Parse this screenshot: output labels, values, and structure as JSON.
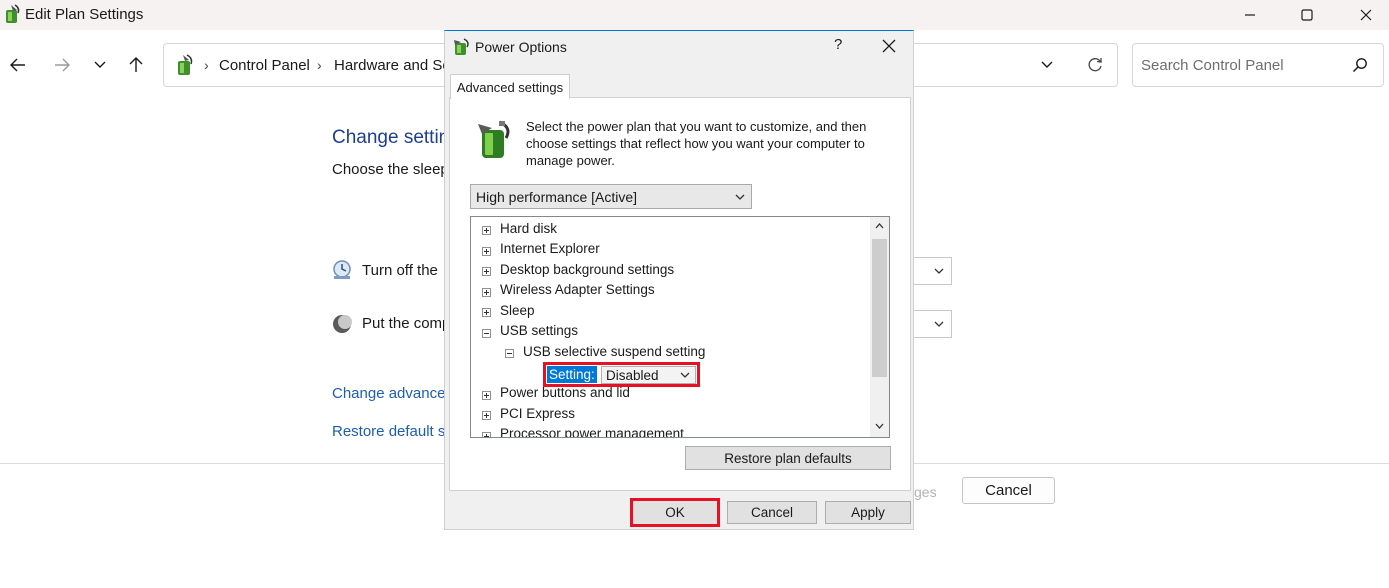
{
  "window": {
    "title": "Edit Plan Settings",
    "minimize_icon": "minimize-icon",
    "maximize_icon": "maximize-icon",
    "close_icon": "close-icon"
  },
  "nav": {
    "back_icon": "arrow-left-icon",
    "forward_icon": "arrow-right-icon",
    "recent_icon": "chevron-down-icon",
    "up_icon": "arrow-up-icon",
    "refresh_icon": "refresh-icon"
  },
  "breadcrumb": {
    "items": [
      "Control Panel",
      "Hardware and So"
    ]
  },
  "search": {
    "placeholder": "Search Control Panel"
  },
  "background_page": {
    "heading": "Change settin",
    "subheading": "Choose the sleep",
    "rows": [
      {
        "label": "Turn off the",
        "icon": "display-icon"
      },
      {
        "label": "Put the comp",
        "icon": "moon-icon"
      }
    ],
    "links": [
      "Change advanced",
      "Restore default s"
    ],
    "save_label": "ges",
    "cancel_label": "Cancel"
  },
  "dialog": {
    "title": "Power Options",
    "help": "?",
    "tab": "Advanced settings",
    "intro": "Select the power plan that you want to customize, and then choose settings that reflect how you want your computer to manage power.",
    "plan_selected": "High performance [Active]",
    "tree": [
      {
        "label": "Hard disk",
        "expanded": false
      },
      {
        "label": "Internet Explorer",
        "expanded": false
      },
      {
        "label": "Desktop background settings",
        "expanded": false
      },
      {
        "label": "Wireless Adapter Settings",
        "expanded": false
      },
      {
        "label": "Sleep",
        "expanded": false
      },
      {
        "label": "USB settings",
        "expanded": true
      },
      {
        "label": "USB selective suspend setting",
        "expanded": true
      },
      {
        "label": "Power buttons and lid",
        "expanded": false
      },
      {
        "label": "PCI Express",
        "expanded": false
      },
      {
        "label": "Processor power management",
        "expanded": false
      }
    ],
    "setting_label": "Setting:",
    "setting_value": "Disabled",
    "restore_button": "Restore plan defaults",
    "ok_button": "OK",
    "cancel_button": "Cancel",
    "apply_button": "Apply",
    "highlight_color": "#e81123",
    "accent_color": "#0078d7"
  }
}
